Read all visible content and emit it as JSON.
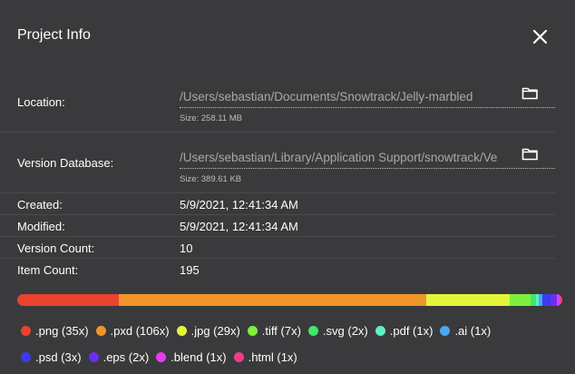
{
  "dialog": {
    "title": "Project Info"
  },
  "location": {
    "label": "Location:",
    "path": "/Users/sebastian/Documents/Snowtrack/Jelly-marbled",
    "size": "Size: 258.11 MB"
  },
  "version_database": {
    "label": "Version Database:",
    "path": "/Users/sebastian/Library/Application Support/snowtrack/Ve",
    "size": "Size: 389.61 KB"
  },
  "details": [
    {
      "label": "Created:",
      "value": "5/9/2021, 12:41:34 AM"
    },
    {
      "label": "Modified:",
      "value": "5/9/2021, 12:41:34 AM"
    },
    {
      "label": "Version Count:",
      "value": "10"
    },
    {
      "label": "Item Count:",
      "value": "195"
    }
  ],
  "file_types": [
    {
      "label": ".png (35x)",
      "count": 35,
      "color": "#e8432e"
    },
    {
      "label": ".pxd (106x)",
      "count": 106,
      "color": "#f0952a"
    },
    {
      "label": ".jpg (29x)",
      "count": 29,
      "color": "#e3f53a"
    },
    {
      "label": ".tiff (7x)",
      "count": 7,
      "color": "#7cf03c"
    },
    {
      "label": ".svg (2x)",
      "count": 2,
      "color": "#3fe86a"
    },
    {
      "label": ".pdf (1x)",
      "count": 1,
      "color": "#5cf0c0"
    },
    {
      "label": ".ai (1x)",
      "count": 1,
      "color": "#4aa8f0"
    },
    {
      "label": ".psd (3x)",
      "count": 3,
      "color": "#3b3bf2"
    },
    {
      "label": ".eps (2x)",
      "count": 2,
      "color": "#6a2ff0"
    },
    {
      "label": ".blend (1x)",
      "count": 1,
      "color": "#e63cf0"
    },
    {
      "label": ".html (1x)",
      "count": 1,
      "color": "#f03c8c"
    }
  ]
}
